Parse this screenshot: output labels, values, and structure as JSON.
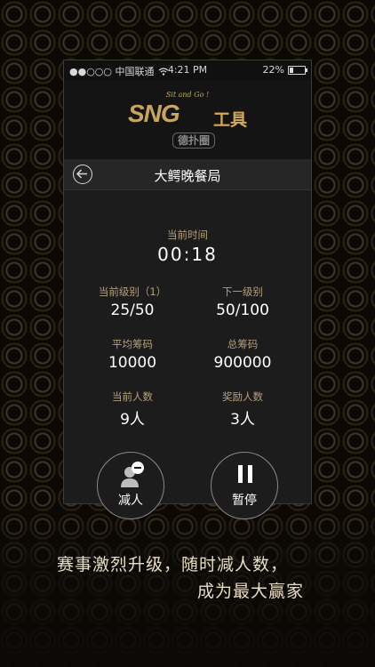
{
  "status_bar": {
    "carrier": "●●○○○ 中国联通",
    "time": "4:21 PM",
    "battery_percent": "22%",
    "battery_level": 0.22
  },
  "logo": {
    "tagline": "Sit and Go !",
    "main": "SNG",
    "tool": "工具",
    "brand": "德扑圈"
  },
  "header": {
    "title": "大鳄晚餐局"
  },
  "timer": {
    "label": "当前时间",
    "value": "00:18"
  },
  "stats": {
    "current_level_label": "当前级别（1）",
    "current_level_value": "25/50",
    "next_level_label": "下一级别",
    "next_level_value": "50/100",
    "avg_chips_label": "平均筹码",
    "avg_chips_value": "10000",
    "total_chips_label": "总筹码",
    "total_chips_value": "900000",
    "players_label": "当前人数",
    "players_value": "9人",
    "paid_label": "奖励人数",
    "paid_value": "3人"
  },
  "actions": {
    "remove_player_label": "减人",
    "pause_label": "暂停"
  },
  "caption": {
    "line1": "赛事激烈升级，随时减人数，",
    "line2": "成为最大赢家"
  },
  "colors": {
    "accent_gold": "#c9a45c",
    "label_gold": "#b3a07a",
    "text": "#ffffff",
    "background": "#0b0906"
  }
}
